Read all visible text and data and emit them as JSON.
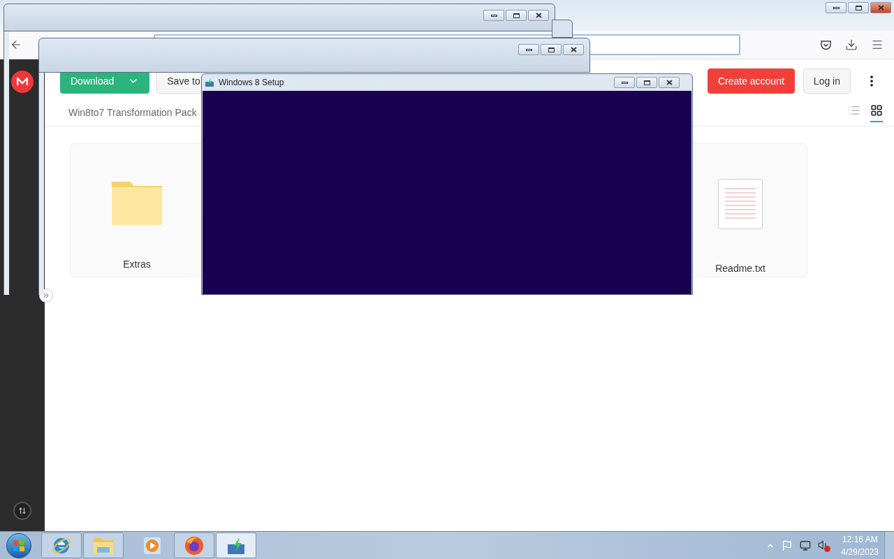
{
  "setup_window": {
    "title": "Windows 8 Setup"
  },
  "page": {
    "actions": [
      {
        "kind": "primary",
        "label": "Download"
      },
      {
        "kind": "secondary",
        "label": "Save to"
      }
    ],
    "breadcrumb": "Win8to7 Transformation Pack",
    "account": [
      {
        "kind": "danger",
        "label": "Create account"
      },
      {
        "kind": "plain",
        "label": "Log in"
      }
    ],
    "views": [
      {
        "kind": "list",
        "selected": false
      },
      {
        "kind": "grid",
        "selected": true
      }
    ],
    "items": [
      {
        "kind": "folder",
        "name": "Extras"
      },
      {
        "kind": "text",
        "name": "Readme.txt"
      }
    ]
  },
  "taskbar": {
    "apps": [
      {
        "kind": "ie",
        "running": true,
        "selected": false
      },
      {
        "kind": "explorer",
        "running": true,
        "selected": false
      },
      {
        "kind": "media",
        "running": false,
        "selected": false
      },
      {
        "kind": "firefox",
        "running": true,
        "selected": false
      },
      {
        "kind": "setup",
        "running": true,
        "selected": true
      }
    ],
    "clock": {
      "time": "12:16 AM",
      "date": "4/29/2023"
    }
  }
}
